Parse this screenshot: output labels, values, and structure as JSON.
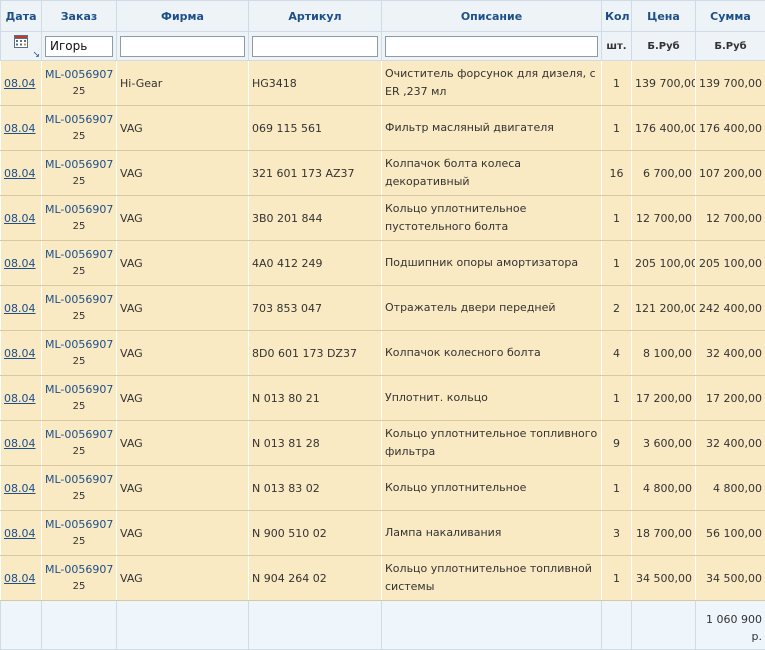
{
  "headers": {
    "date": "Дата",
    "order": "Заказ",
    "firm": "Фирма",
    "article": "Артикул",
    "description": "Описание",
    "qty": "Кол",
    "price": "Цена",
    "sum": "Сумма"
  },
  "filters": {
    "order_value": "Игорь",
    "firm_value": "",
    "article_value": "",
    "description_value": ""
  },
  "units": {
    "qty": "шт.",
    "price": "Б.Руб",
    "sum": "Б.Руб"
  },
  "rows": [
    {
      "date": "08.04",
      "order": "ML-0056907",
      "order_sub": "25",
      "firm": "Hi-Gear",
      "article": "HG3418",
      "description": "Очиститель форсунок для дизеля, с ER ,237 мл",
      "qty": "1",
      "price": "139 700,00",
      "sum": "139 700,00"
    },
    {
      "date": "08.04",
      "order": "ML-0056907",
      "order_sub": "25",
      "firm": "VAG",
      "article": "069 115 561",
      "description": "Фильтр масляный двигателя",
      "qty": "1",
      "price": "176 400,00",
      "sum": "176 400,00"
    },
    {
      "date": "08.04",
      "order": "ML-0056907",
      "order_sub": "25",
      "firm": "VAG",
      "article": "321 601 173 AZ37",
      "description": "Колпачок болта колеса декоративный",
      "qty": "16",
      "price": "6 700,00",
      "sum": "107 200,00"
    },
    {
      "date": "08.04",
      "order": "ML-0056907",
      "order_sub": "25",
      "firm": "VAG",
      "article": "3B0 201 844",
      "description": "Кольцо уплотнительное пустотельного болта",
      "qty": "1",
      "price": "12 700,00",
      "sum": "12 700,00"
    },
    {
      "date": "08.04",
      "order": "ML-0056907",
      "order_sub": "25",
      "firm": "VAG",
      "article": "4A0 412 249",
      "description": "Подшипник опоры амортизатора",
      "qty": "1",
      "price": "205 100,00",
      "sum": "205 100,00"
    },
    {
      "date": "08.04",
      "order": "ML-0056907",
      "order_sub": "25",
      "firm": "VAG",
      "article": "703 853 047",
      "description": "Отражатель двери передней",
      "qty": "2",
      "price": "121 200,00",
      "sum": "242 400,00"
    },
    {
      "date": "08.04",
      "order": "ML-0056907",
      "order_sub": "25",
      "firm": "VAG",
      "article": "8D0 601 173 DZ37",
      "description": "Колпачок колесного болта",
      "qty": "4",
      "price": "8 100,00",
      "sum": "32 400,00"
    },
    {
      "date": "08.04",
      "order": "ML-0056907",
      "order_sub": "25",
      "firm": "VAG",
      "article": "N 013 80 21",
      "description": "Уплотнит. кольцо",
      "qty": "1",
      "price": "17 200,00",
      "sum": "17 200,00"
    },
    {
      "date": "08.04",
      "order": "ML-0056907",
      "order_sub": "25",
      "firm": "VAG",
      "article": "N 013 81 28",
      "description": "Кольцо уплотнительное топливного фильтра",
      "qty": "9",
      "price": "3 600,00",
      "sum": "32 400,00"
    },
    {
      "date": "08.04",
      "order": "ML-0056907",
      "order_sub": "25",
      "firm": "VAG",
      "article": "N 013 83 02",
      "description": "Кольцо уплотнительное",
      "qty": "1",
      "price": "4 800,00",
      "sum": "4 800,00"
    },
    {
      "date": "08.04",
      "order": "ML-0056907",
      "order_sub": "25",
      "firm": "VAG",
      "article": "N 900 510 02",
      "description": "Лампа накаливания",
      "qty": "3",
      "price": "18 700,00",
      "sum": "56 100,00"
    },
    {
      "date": "08.04",
      "order": "ML-0056907",
      "order_sub": "25",
      "firm": "VAG",
      "article": "N 904 264 02",
      "description": "Кольцо уплотнительное топливной системы",
      "qty": "1",
      "price": "34 500,00",
      "sum": "34 500,00"
    }
  ],
  "footer": {
    "total": "1 060 900 р."
  },
  "icons": {
    "calendar": "calendar-icon",
    "sort": "sort-arrow-icon"
  },
  "colors": {
    "header_bg": "#eef3f8",
    "header_text": "#1d4f8a",
    "row_bg": "#faeac4",
    "link": "#1d4f8a"
  }
}
